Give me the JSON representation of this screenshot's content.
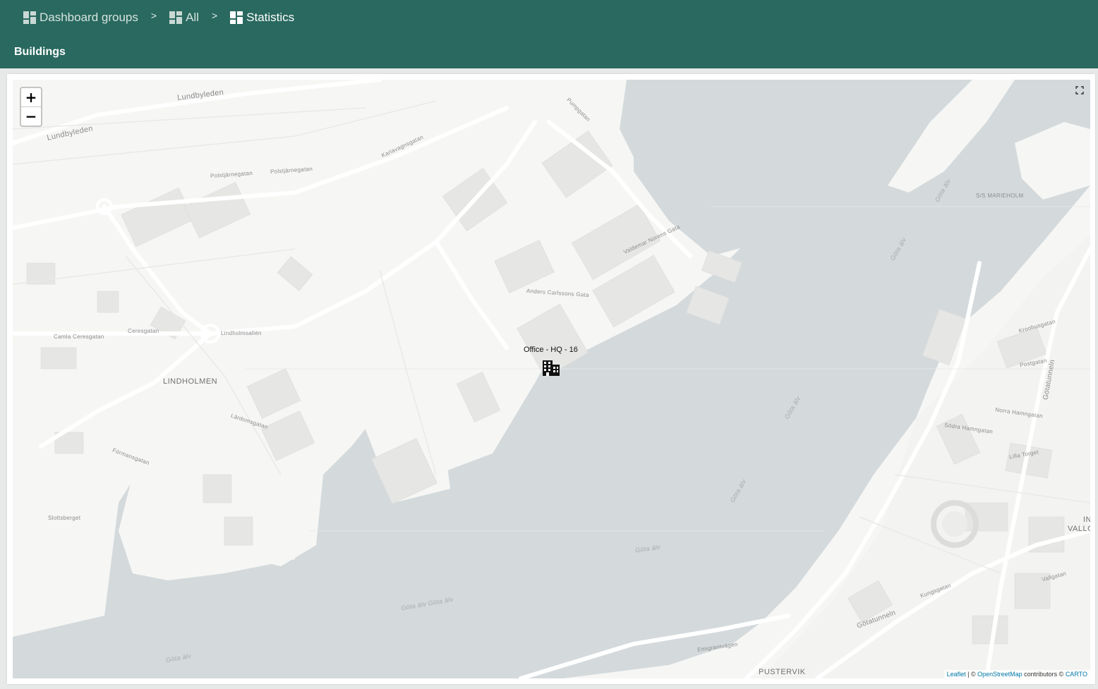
{
  "breadcrumb": {
    "items": [
      {
        "label": "Dashboard groups",
        "icon": "dashboard-grid-icon"
      },
      {
        "label": "All",
        "icon": "dashboard-grid-icon"
      },
      {
        "label": "Statistics",
        "icon": "dashboard-grid-icon"
      }
    ],
    "separator": ">"
  },
  "page": {
    "title": "Buildings"
  },
  "map": {
    "zoom_in": "+",
    "zoom_out": "−",
    "marker": {
      "label": "Office - HQ - 16",
      "icon": "building-icon"
    },
    "attribution": {
      "leaflet": "Leaflet",
      "sep1": " | © ",
      "osm": "OpenStreetMap",
      "mid": " contributors © ",
      "carto": "CARTO"
    },
    "labels": {
      "lundbyleden_1": "Lundbyleden",
      "lundbyleden_2": "Lundbyleden",
      "lindholmen": "LINDHOLMEN",
      "pustervik": "PUSTERVIK",
      "ss_marieholm": "S/S MARIEHOLM",
      "polstjarnegatan": "Polstjärnegatan",
      "polstjarnegatan_2": "Polstjärnegatan",
      "karlavagnsgatan": "Karlavagnsgatan",
      "lindholmsallen": "Lindholmsallén",
      "camla_ceresgatan": "Camla Ceresgatan",
      "ceresgatan": "Ceresgatan",
      "anders_carlssons": "Anders Carlssons Gata",
      "pumpgatan": "Pumpgatan",
      "valdemar": "Valdemar Norens Gata",
      "gota_alv_1": "Göta älv",
      "gota_alv_2": "Göta älv",
      "gota_alv_3": "Göta älv",
      "gota_alv_4": "Göta älv",
      "gota_alv_5": "Göta älv Göta älv",
      "gota_alv_6": "Göta älv",
      "gota_alv_7": "Göta älv",
      "gotatunneln": "Götatunneln",
      "gotatunneln_2": "Götatunneln",
      "emigrantvagen": "Emigrantvägen",
      "lardomsgatan": "Lärdomsgatan",
      "slottsberget": "Slottsberget",
      "formansgatan": "Förmansgatan",
      "postgatan": "Postgatan",
      "kungsgatan": "Kungsgatan",
      "sodra_hamngatan": "Södra Hamngatan",
      "norra_hamngatan": "Norra Hamngatan",
      "lilla_torget": "Lilla Torget",
      "vallgatan": "Vallgatan",
      "kronhusgatan": "Kronhusgatan",
      "vallo": "VALLO",
      "in": "IN"
    }
  }
}
